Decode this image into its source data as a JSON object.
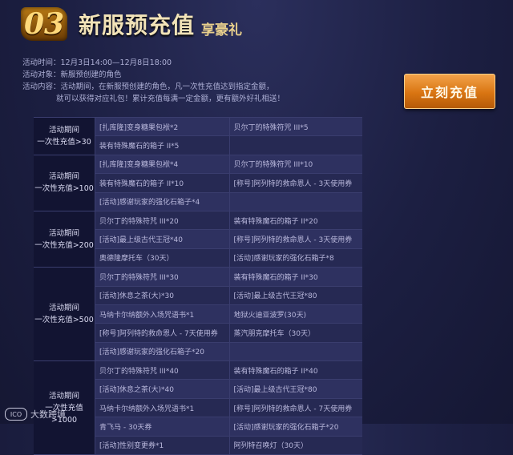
{
  "header": {
    "number": "03",
    "title": "新服预充值",
    "subtitle": "享豪礼"
  },
  "info": {
    "time_label": "活动时间：",
    "time_value": "12月3日14:00—12月8日18:00",
    "target_label": "活动对象：",
    "target_value": "新服预创建的角色",
    "content_label": "活动内容：",
    "content_line1": "活动期间，在新服预创建的角色，凡一次性充值达到指定金额，",
    "content_line2": "就可以获得对应礼包！累计充值每满一定金额，更有额外好礼相送！"
  },
  "recharge_button": "立刻充值",
  "groups": [
    {
      "label_line1": "活动期间",
      "label_line2": "一次性充值>30",
      "rows": [
        [
          "[扎库隆]变身糖果包袱*2",
          "贝尔丁的特殊符咒 III*5"
        ],
        [
          "装有特殊魔石的箱子 II*5",
          ""
        ]
      ]
    },
    {
      "label_line1": "活动期间",
      "label_line2": "一次性充值>100",
      "rows": [
        [
          "[扎库隆]变身糖果包袱*4",
          "贝尔丁的特殊符咒 III*10"
        ],
        [
          "装有特殊魔石的箱子 II*10",
          "[称号]阿列特的救命恩人 - 3天使用券"
        ],
        [
          "[活动]感谢玩家的强化石箱子*4",
          ""
        ]
      ]
    },
    {
      "label_line1": "活动期间",
      "label_line2": "一次性充值>200",
      "rows": [
        [
          "贝尔丁的特殊符咒 III*20",
          "装有特殊魔石的箱子 II*20"
        ],
        [
          "[活动]最上级古代王冠*40",
          "[称号]阿列特的救命恩人 - 3天使用券"
        ],
        [
          "奥德隆摩托车（30天）",
          "[活动]感谢玩家的强化石箱子*8"
        ]
      ]
    },
    {
      "label_line1": "活动期间",
      "label_line2": "一次性充值>500",
      "rows": [
        [
          "贝尔丁的特殊符咒 III*30",
          "装有特殊魔石的箱子 II*30"
        ],
        [
          "[活动]休息之茶(大)*30",
          "[活动]最上级古代王冠*80"
        ],
        [
          "马纳卡尔纳额外入场咒语书*1",
          "地狱火迪亚波罗(30天)"
        ],
        [
          "[称号]阿列特的救命恩人 - 7天使用券",
          "蒸汽朋克摩托车（30天）"
        ],
        [
          "[活动]感谢玩家的强化石箱子*20",
          ""
        ]
      ]
    },
    {
      "label_line1": "活动期间",
      "label_line2": "一次性充值>1000",
      "rows": [
        [
          "贝尔丁的特殊符咒 III*40",
          "装有特殊魔石的箱子 II*40"
        ],
        [
          "[活动]休息之茶(大)*40",
          "[活动]最上级古代王冠*80"
        ],
        [
          "马纳卡尔纳额外入场咒语书*1",
          "[称号]阿列特的救命恩人 - 7天使用券"
        ],
        [
          "青飞马 - 30天券",
          "[活动]感谢玩家的强化石箱子*20"
        ],
        [
          "[活动]性别变更券*1",
          "阿列特召唤灯（30天）"
        ]
      ]
    }
  ],
  "watermark": {
    "logo": "ICO",
    "text": "大数跨境"
  }
}
